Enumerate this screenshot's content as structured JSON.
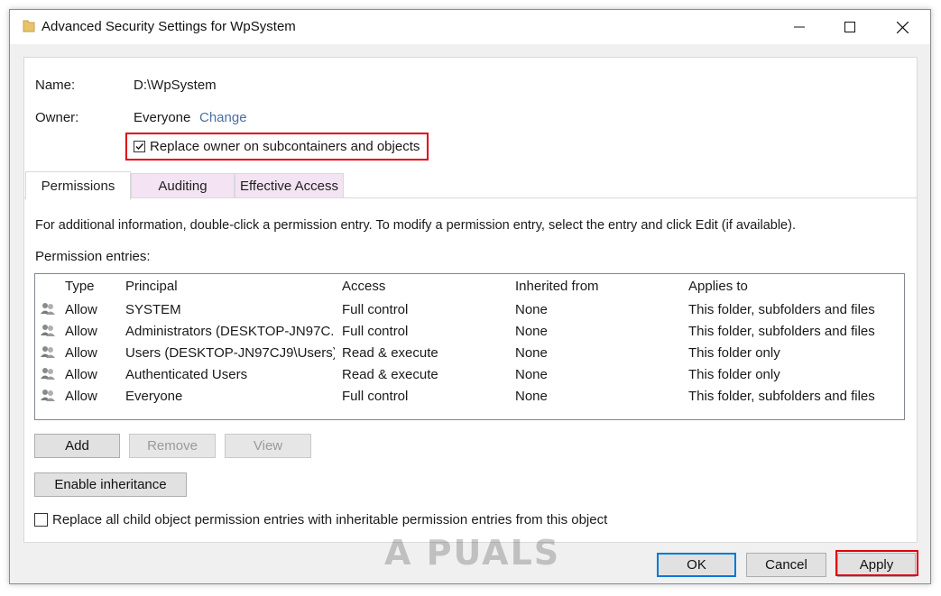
{
  "window": {
    "title": "Advanced Security Settings for WpSystem"
  },
  "fields": {
    "name_label": "Name:",
    "name_value": "D:\\WpSystem",
    "owner_label": "Owner:",
    "owner_value": "Everyone",
    "change_link": "Change",
    "replace_owner_label": "Replace owner on subcontainers and objects",
    "replace_owner_checked": true
  },
  "tabs": [
    {
      "label": "Permissions",
      "active": true
    },
    {
      "label": "Auditing",
      "active": false
    },
    {
      "label": "Effective Access",
      "active": false
    }
  ],
  "permissions": {
    "info_text": "For additional information, double-click a permission entry. To modify a permission entry, select the entry and click Edit (if available).",
    "entries_label": "Permission entries:",
    "columns": [
      "Type",
      "Principal",
      "Access",
      "Inherited from",
      "Applies to"
    ],
    "rows": [
      {
        "type": "Allow",
        "principal": "SYSTEM",
        "access": "Full control",
        "inherited": "None",
        "applies": "This folder, subfolders and files"
      },
      {
        "type": "Allow",
        "principal": "Administrators (DESKTOP-JN97C...",
        "access": "Full control",
        "inherited": "None",
        "applies": "This folder, subfolders and files"
      },
      {
        "type": "Allow",
        "principal": "Users (DESKTOP-JN97CJ9\\Users)",
        "access": "Read & execute",
        "inherited": "None",
        "applies": "This folder only"
      },
      {
        "type": "Allow",
        "principal": "Authenticated Users",
        "access": "Read & execute",
        "inherited": "None",
        "applies": "This folder only"
      },
      {
        "type": "Allow",
        "principal": "Everyone",
        "access": "Full control",
        "inherited": "None",
        "applies": "This folder, subfolders and files"
      }
    ]
  },
  "buttons": {
    "add": "Add",
    "remove": "Remove",
    "view": "View",
    "enable_inheritance": "Enable inheritance",
    "ok": "OK",
    "cancel": "Cancel",
    "apply": "Apply"
  },
  "replace_child": {
    "label": "Replace all child object permission entries with inheritable permission entries from this object",
    "checked": false
  },
  "watermark": "A PUALS",
  "colors": {
    "highlight_red": "#e00010",
    "tab_inactive": "#f3e3f3",
    "link": "#4a6fa5",
    "default_button_border": "#0078d7"
  }
}
